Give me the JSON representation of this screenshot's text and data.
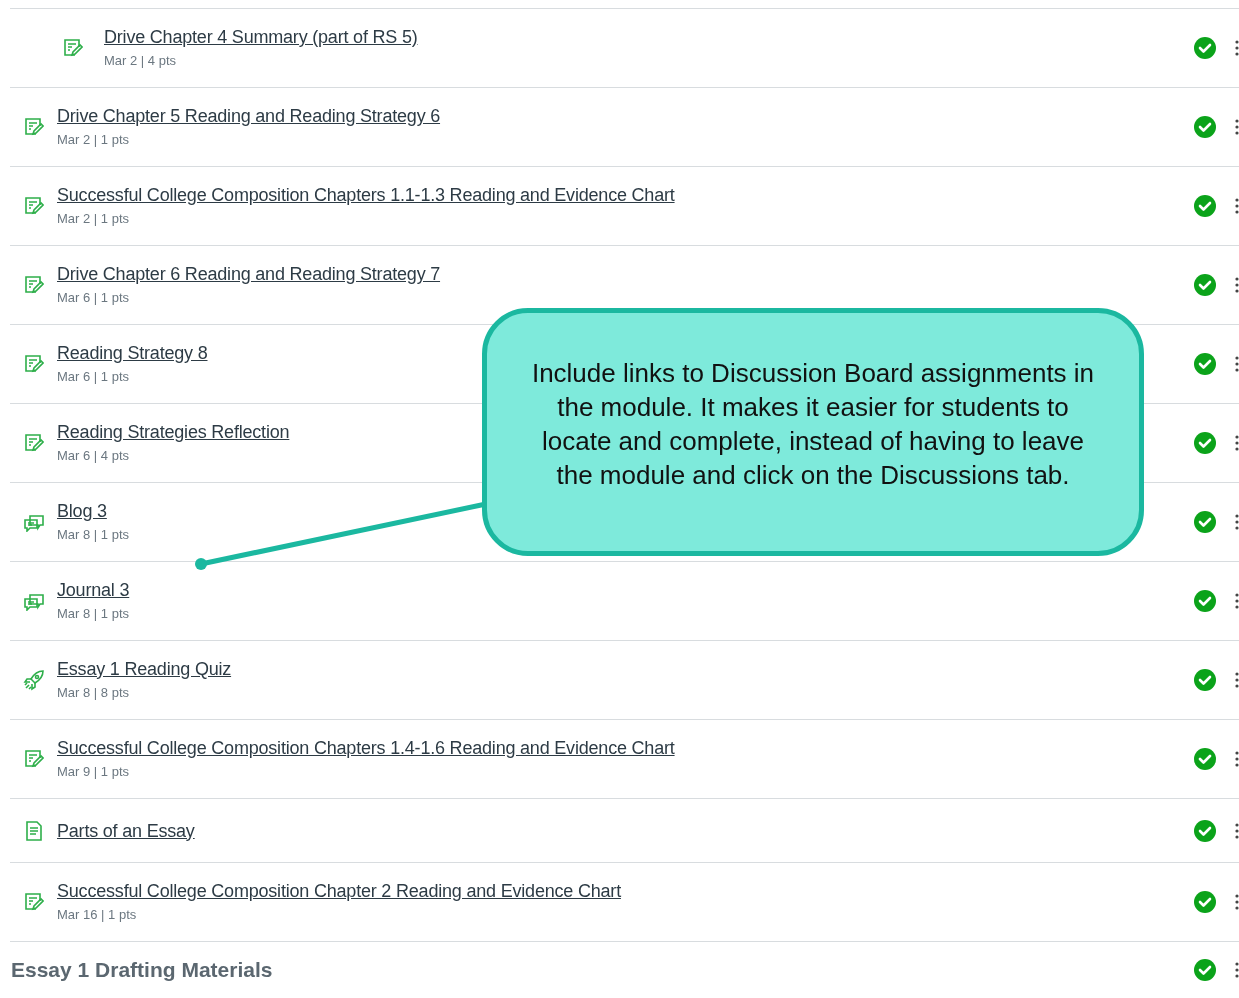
{
  "items": [
    {
      "kind": "assignment",
      "indented": true,
      "title": "Drive Chapter 4 Summary (part of RS 5)",
      "meta": "Mar 2 | 4 pts",
      "completed": true
    },
    {
      "kind": "assignment",
      "indented": false,
      "title": "Drive Chapter 5 Reading and Reading Strategy 6",
      "meta": "Mar 2 | 1 pts",
      "completed": true
    },
    {
      "kind": "assignment",
      "indented": false,
      "title": "Successful College Composition Chapters 1.1-1.3 Reading and Evidence Chart",
      "meta": "Mar 2 | 1 pts",
      "completed": true
    },
    {
      "kind": "assignment",
      "indented": false,
      "title": "Drive Chapter 6 Reading and Reading Strategy 7",
      "meta": "Mar 6 | 1 pts",
      "completed": true
    },
    {
      "kind": "assignment",
      "indented": false,
      "title": "Reading Strategy 8",
      "meta": "Mar 6 | 1 pts",
      "completed": true
    },
    {
      "kind": "assignment",
      "indented": false,
      "title": "Reading Strategies Reflection",
      "meta": "Mar 6 | 4 pts",
      "completed": true
    },
    {
      "kind": "discussion",
      "indented": false,
      "title": "Blog 3",
      "meta": "Mar 8 | 1 pts",
      "completed": true
    },
    {
      "kind": "discussion",
      "indented": false,
      "title": "Journal 3",
      "meta": "Mar 8 | 1 pts",
      "completed": true
    },
    {
      "kind": "quiz",
      "indented": false,
      "title": "Essay 1 Reading Quiz",
      "meta": "Mar 8 | 8 pts",
      "completed": true
    },
    {
      "kind": "assignment",
      "indented": false,
      "title": "Successful College Composition Chapters 1.4-1.6 Reading and Evidence Chart",
      "meta": "Mar 9 | 1 pts",
      "completed": true
    },
    {
      "kind": "page",
      "indented": false,
      "title": "Parts of an Essay",
      "completed": true
    },
    {
      "kind": "assignment",
      "indented": false,
      "title": "Successful College Composition Chapter 2 Reading and Evidence Chart",
      "meta": "Mar 16 | 1 pts",
      "completed": true
    }
  ],
  "next_module": {
    "title": "Essay 1 Drafting Materials",
    "completed": true
  },
  "callout": {
    "text": "Include links to Discussion Board assignments in the module. It makes it easier for students to locate and complete, instead of having to leave the module and click on the Discussions tab."
  }
}
